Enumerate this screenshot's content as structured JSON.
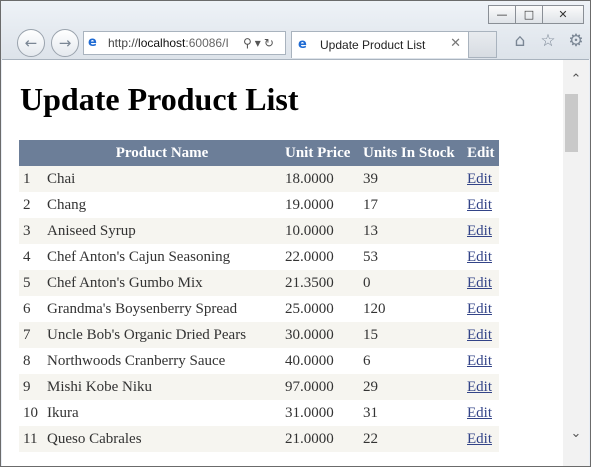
{
  "browser": {
    "url_prefix": "http://",
    "url_host": "localhost",
    "url_port": ":60086/I",
    "tab_title": "Update Product List"
  },
  "page": {
    "heading": "Update Product List"
  },
  "table": {
    "headers": [
      "",
      "Product Name",
      "Unit Price",
      "Units In Stock",
      "Edit"
    ],
    "rows": [
      {
        "id": "1",
        "name": "Chai",
        "price": "18.0000",
        "stock": "39",
        "edit": "Edit"
      },
      {
        "id": "2",
        "name": "Chang",
        "price": "19.0000",
        "stock": "17",
        "edit": "Edit"
      },
      {
        "id": "3",
        "name": "Aniseed Syrup",
        "price": "10.0000",
        "stock": "13",
        "edit": "Edit"
      },
      {
        "id": "4",
        "name": "Chef Anton's Cajun Seasoning",
        "price": "22.0000",
        "stock": "53",
        "edit": "Edit"
      },
      {
        "id": "5",
        "name": "Chef Anton's Gumbo Mix",
        "price": "21.3500",
        "stock": "0",
        "edit": "Edit"
      },
      {
        "id": "6",
        "name": "Grandma's Boysenberry Spread",
        "price": "25.0000",
        "stock": "120",
        "edit": "Edit"
      },
      {
        "id": "7",
        "name": "Uncle Bob's Organic Dried Pears",
        "price": "30.0000",
        "stock": "15",
        "edit": "Edit"
      },
      {
        "id": "8",
        "name": "Northwoods Cranberry Sauce",
        "price": "40.0000",
        "stock": "6",
        "edit": "Edit"
      },
      {
        "id": "9",
        "name": "Mishi Kobe Niku",
        "price": "97.0000",
        "stock": "29",
        "edit": "Edit"
      },
      {
        "id": "10",
        "name": "Ikura",
        "price": "31.0000",
        "stock": "31",
        "edit": "Edit"
      },
      {
        "id": "11",
        "name": "Queso Cabrales",
        "price": "21.0000",
        "stock": "22",
        "edit": "Edit"
      }
    ]
  },
  "colors": {
    "header_bg": "#6c7e98",
    "row_alt_bg": "#f6f5f0",
    "link": "#334488"
  },
  "icons": [
    "back-icon",
    "forward-icon",
    "ie-logo-icon",
    "search-icon",
    "dropdown-icon",
    "refresh-icon",
    "close-tab-icon",
    "home-icon",
    "favorites-star-icon",
    "settings-gear-icon",
    "minimize-icon",
    "maximize-icon",
    "close-icon",
    "scroll-up-icon",
    "scroll-down-icon"
  ]
}
